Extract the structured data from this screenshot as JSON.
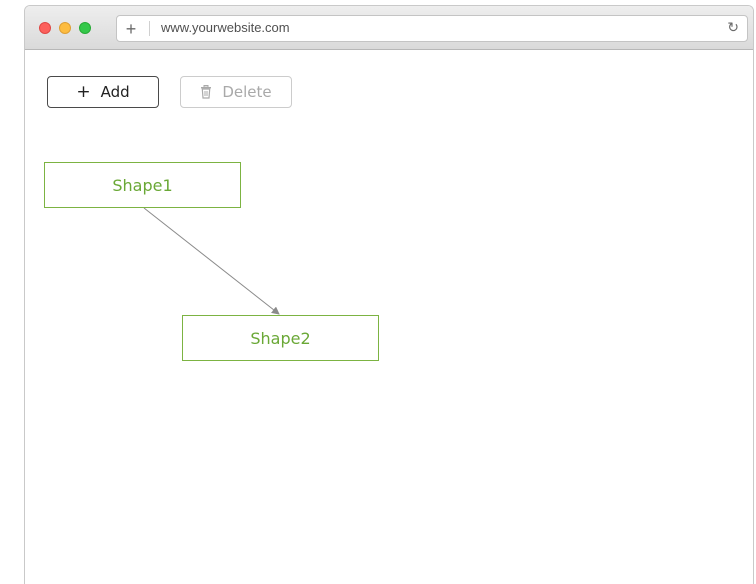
{
  "browser": {
    "url": "www.yourwebsite.com",
    "new_tab_glyph": "+",
    "reload_glyph": "↻"
  },
  "toolbar": {
    "add": {
      "icon": "plus-icon",
      "glyph": "+",
      "label": "Add"
    },
    "delete": {
      "icon": "trash-icon",
      "label": "Delete",
      "enabled": false
    }
  },
  "diagram": {
    "nodes": [
      {
        "label": "Shape1"
      },
      {
        "label": "Shape2"
      }
    ],
    "edges": [
      {
        "from": "Shape1",
        "to": "Shape2"
      }
    ]
  },
  "colors": {
    "shape_border": "#7cb342",
    "shape_text": "#6aa836",
    "connector": "#8a8a8a",
    "close": "#fc605c",
    "minimize": "#fdbc40",
    "maximize": "#34c84a"
  }
}
